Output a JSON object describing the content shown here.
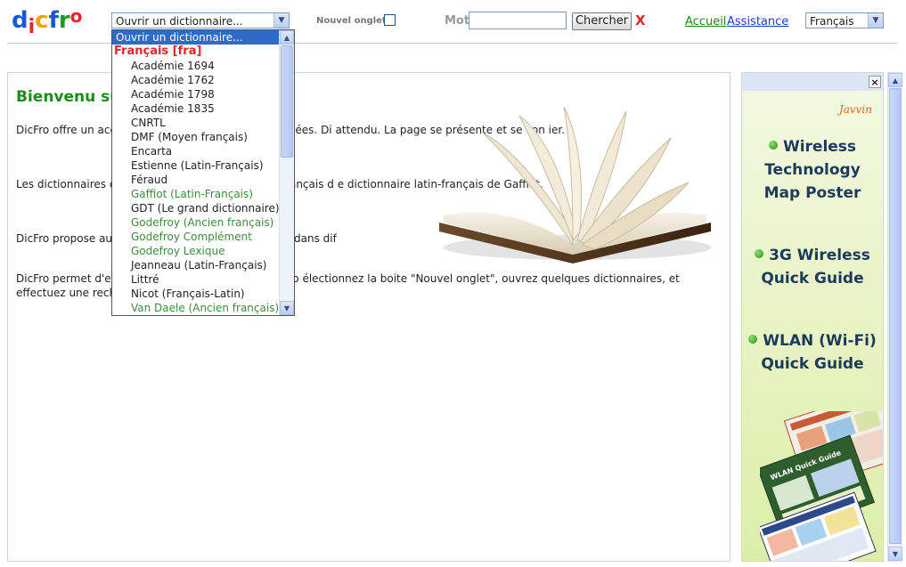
{
  "logo": {
    "letters": [
      "d",
      "i",
      "c",
      "f",
      "r",
      "o"
    ]
  },
  "header": {
    "dict_select_value": "Ouvrir un dictionnaire...",
    "nouvel_onglet_label": "Nouvel onglet",
    "mot_label": "Mot",
    "mot_value": "",
    "search_button": "Chercher",
    "clear_label": "X",
    "accueil_link": "Accueil",
    "assistance_link": "Assistance",
    "language_value": "Français"
  },
  "dropdown": {
    "items": [
      {
        "label": "Ouvrir un dictionnaire...",
        "kind": "sel"
      },
      {
        "label": "Français [fra]",
        "kind": "group"
      },
      {
        "label": "Académie 1694",
        "kind": "plain"
      },
      {
        "label": "Académie 1762",
        "kind": "plain"
      },
      {
        "label": "Académie 1798",
        "kind": "plain"
      },
      {
        "label": "Académie 1835",
        "kind": "plain"
      },
      {
        "label": "CNRTL",
        "kind": "plain"
      },
      {
        "label": "DMF (Moyen français)",
        "kind": "plain"
      },
      {
        "label": "Encarta",
        "kind": "plain"
      },
      {
        "label": "Estienne (Latin-Français)",
        "kind": "plain"
      },
      {
        "label": "Féraud",
        "kind": "plain"
      },
      {
        "label": "Gaffiot (Latin-Français)",
        "kind": "green"
      },
      {
        "label": "GDT (Le grand dictionnaire)",
        "kind": "plain"
      },
      {
        "label": "Godefroy (Ancien français)",
        "kind": "green"
      },
      {
        "label": "Godefroy Complément",
        "kind": "green"
      },
      {
        "label": "Godefroy Lexique",
        "kind": "green"
      },
      {
        "label": "Jeanneau (Latin-Français)",
        "kind": "plain"
      },
      {
        "label": "Littré",
        "kind": "plain"
      },
      {
        "label": "Nicot (Français-Latin)",
        "kind": "plain"
      },
      {
        "label": "Van Daele (Ancien français)",
        "kind": "green"
      }
    ]
  },
  "main": {
    "title": "Bienvenu su",
    "paragraphs": [
      "DicFro offre un acc                                                s dont les pages ont été numérisées. Di                                             attendu. La page se présente et se con                                              ier.",
      "Les dictionnaires d                                                onnaire et le lexique d'ancien français d                                            e dictionnaire latin-français de Gaffiot.",
      "DicFro propose aus                                                 onnaires disponibles sur le toile dans dif",
      "DicFro permet d'eff                                                sur plusieurs dictionnaires à la fo                                              électionnez la boite \"Nouvel onglet\", ouvrez quelques dictionnaires, et effectuez une recherche dans l'un"
    ]
  },
  "ad": {
    "brand": "Javvin",
    "lines": [
      {
        "text": "Wireless",
        "bullet": true
      },
      {
        "text": "Technology",
        "bullet": false
      },
      {
        "text": "Map Poster",
        "bullet": false
      },
      {
        "text": "3G Wireless",
        "bullet": true
      },
      {
        "text": "Quick Guide",
        "bullet": false
      },
      {
        "text": "WLAN (Wi-Fi)",
        "bullet": true
      },
      {
        "text": "Quick Guide",
        "bullet": false
      }
    ],
    "poster_caption": "WLAN Quick Guide",
    "close_label": "×"
  },
  "colors": {
    "accent_green": "#1b8b1b",
    "link_blue": "#1a3cd8",
    "clear_red": "#e0262a",
    "selection": "#316ac5"
  }
}
